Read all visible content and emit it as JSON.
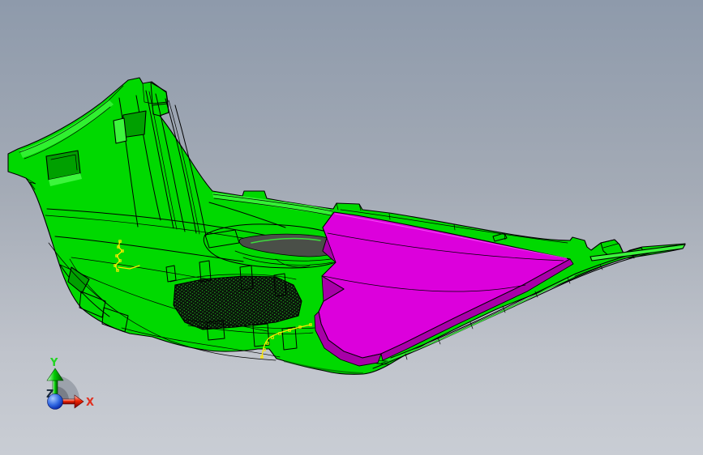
{
  "axis_triad": {
    "x_label": "X",
    "y_label": "Y",
    "z_label": "Z"
  },
  "colors": {
    "background_top": "#8e9aab",
    "background_bottom": "#c9cdd4",
    "model_green": "#00d900",
    "model_green_light": "#3cf53c",
    "model_green_dark": "#00a000",
    "selection_magenta": "#dc00dc",
    "selection_magenta_dark": "#a800a8",
    "edge_black": "#000000",
    "grille_dark": "#0a0f0a",
    "recess_gray": "#4a4f48",
    "sketch_yellow": "#ffe800",
    "axis_x_red": "#e03020",
    "axis_y_green": "#21d421",
    "axis_z_blue": "#2244cc"
  }
}
